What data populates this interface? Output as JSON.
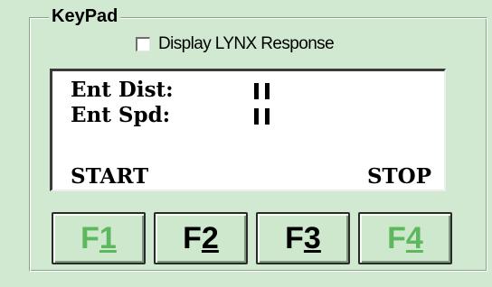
{
  "keypad": {
    "title": "KeyPad",
    "display_checkbox": {
      "label": "Display LYNX Response",
      "checked": false
    }
  },
  "lcd": {
    "line1_label": "Ent Dist:",
    "line2_label": "Ent Spd:",
    "softkey_left": "START",
    "softkey_right": "STOP"
  },
  "fkeys": [
    {
      "prefix": "F",
      "digit": "1",
      "color": "#5db85d"
    },
    {
      "prefix": "F",
      "digit": "2",
      "color": "#000000"
    },
    {
      "prefix": "F",
      "digit": "3",
      "color": "#000000"
    },
    {
      "prefix": "F",
      "digit": "4",
      "color": "#5db85d"
    }
  ],
  "colors": {
    "panel_bg": "#d1e8d1",
    "enabled_key_text": "#000000",
    "highlight_key_text": "#5db85d"
  }
}
